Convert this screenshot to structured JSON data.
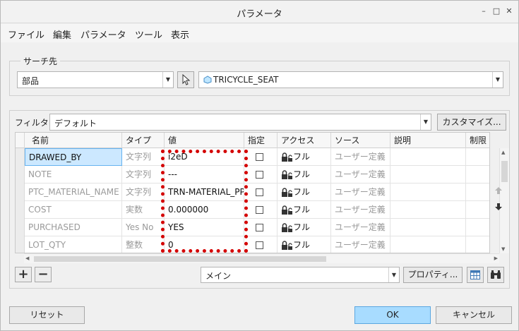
{
  "window": {
    "title": "パラメータ",
    "minimize": "–",
    "maximize": "□",
    "close": "✕"
  },
  "menu": [
    "ファイル",
    "編集",
    "パラメータ",
    "ツール",
    "表示"
  ],
  "search_group": {
    "legend": "サーチ先",
    "scope_value": "部品",
    "object_value": "TRICYCLE_SEAT"
  },
  "filter": {
    "label": "フィルタ",
    "value": "デフォルト",
    "customize_label": "カスタマイズ..."
  },
  "table": {
    "columns": [
      "名前",
      "タイプ",
      "値",
      "指定",
      "アクセス",
      "ソース",
      "説明",
      "制限"
    ],
    "rows": [
      {
        "name": "DRAWED_BY",
        "type": "文字列",
        "value": "i2eD",
        "access": "フル",
        "source": "ユーザー定義",
        "selected": true
      },
      {
        "name": "NOTE",
        "type": "文字列",
        "value": "---",
        "access": "フル",
        "source": "ユーザー定義",
        "selected": false
      },
      {
        "name": "PTC_MATERIAL_NAME",
        "type": "文字列",
        "value": "TRN-MATERIAL_PP",
        "access": "フル",
        "source": "ユーザー定義",
        "selected": false
      },
      {
        "name": "COST",
        "type": "実数",
        "value": "0.000000",
        "access": "フル",
        "source": "ユーザー定義",
        "selected": false
      },
      {
        "name": "PURCHASED",
        "type": "Yes No",
        "value": "YES",
        "access": "フル",
        "source": "ユーザー定義",
        "selected": false
      },
      {
        "name": "LOT_QTY",
        "type": "整数",
        "value": "0",
        "access": "フル",
        "source": "ユーザー定義",
        "selected": false
      }
    ]
  },
  "bottom_toolbar": {
    "add": "+",
    "remove": "−",
    "view_value": "メイン",
    "properties_label": "プロパティ..."
  },
  "footer": {
    "reset_label": "リセット",
    "ok_label": "OK",
    "cancel_label": "キャンセル"
  },
  "colors": {
    "accent": "#a8dcff",
    "selection": "#cce8ff",
    "highlight_box": "#d40000"
  }
}
